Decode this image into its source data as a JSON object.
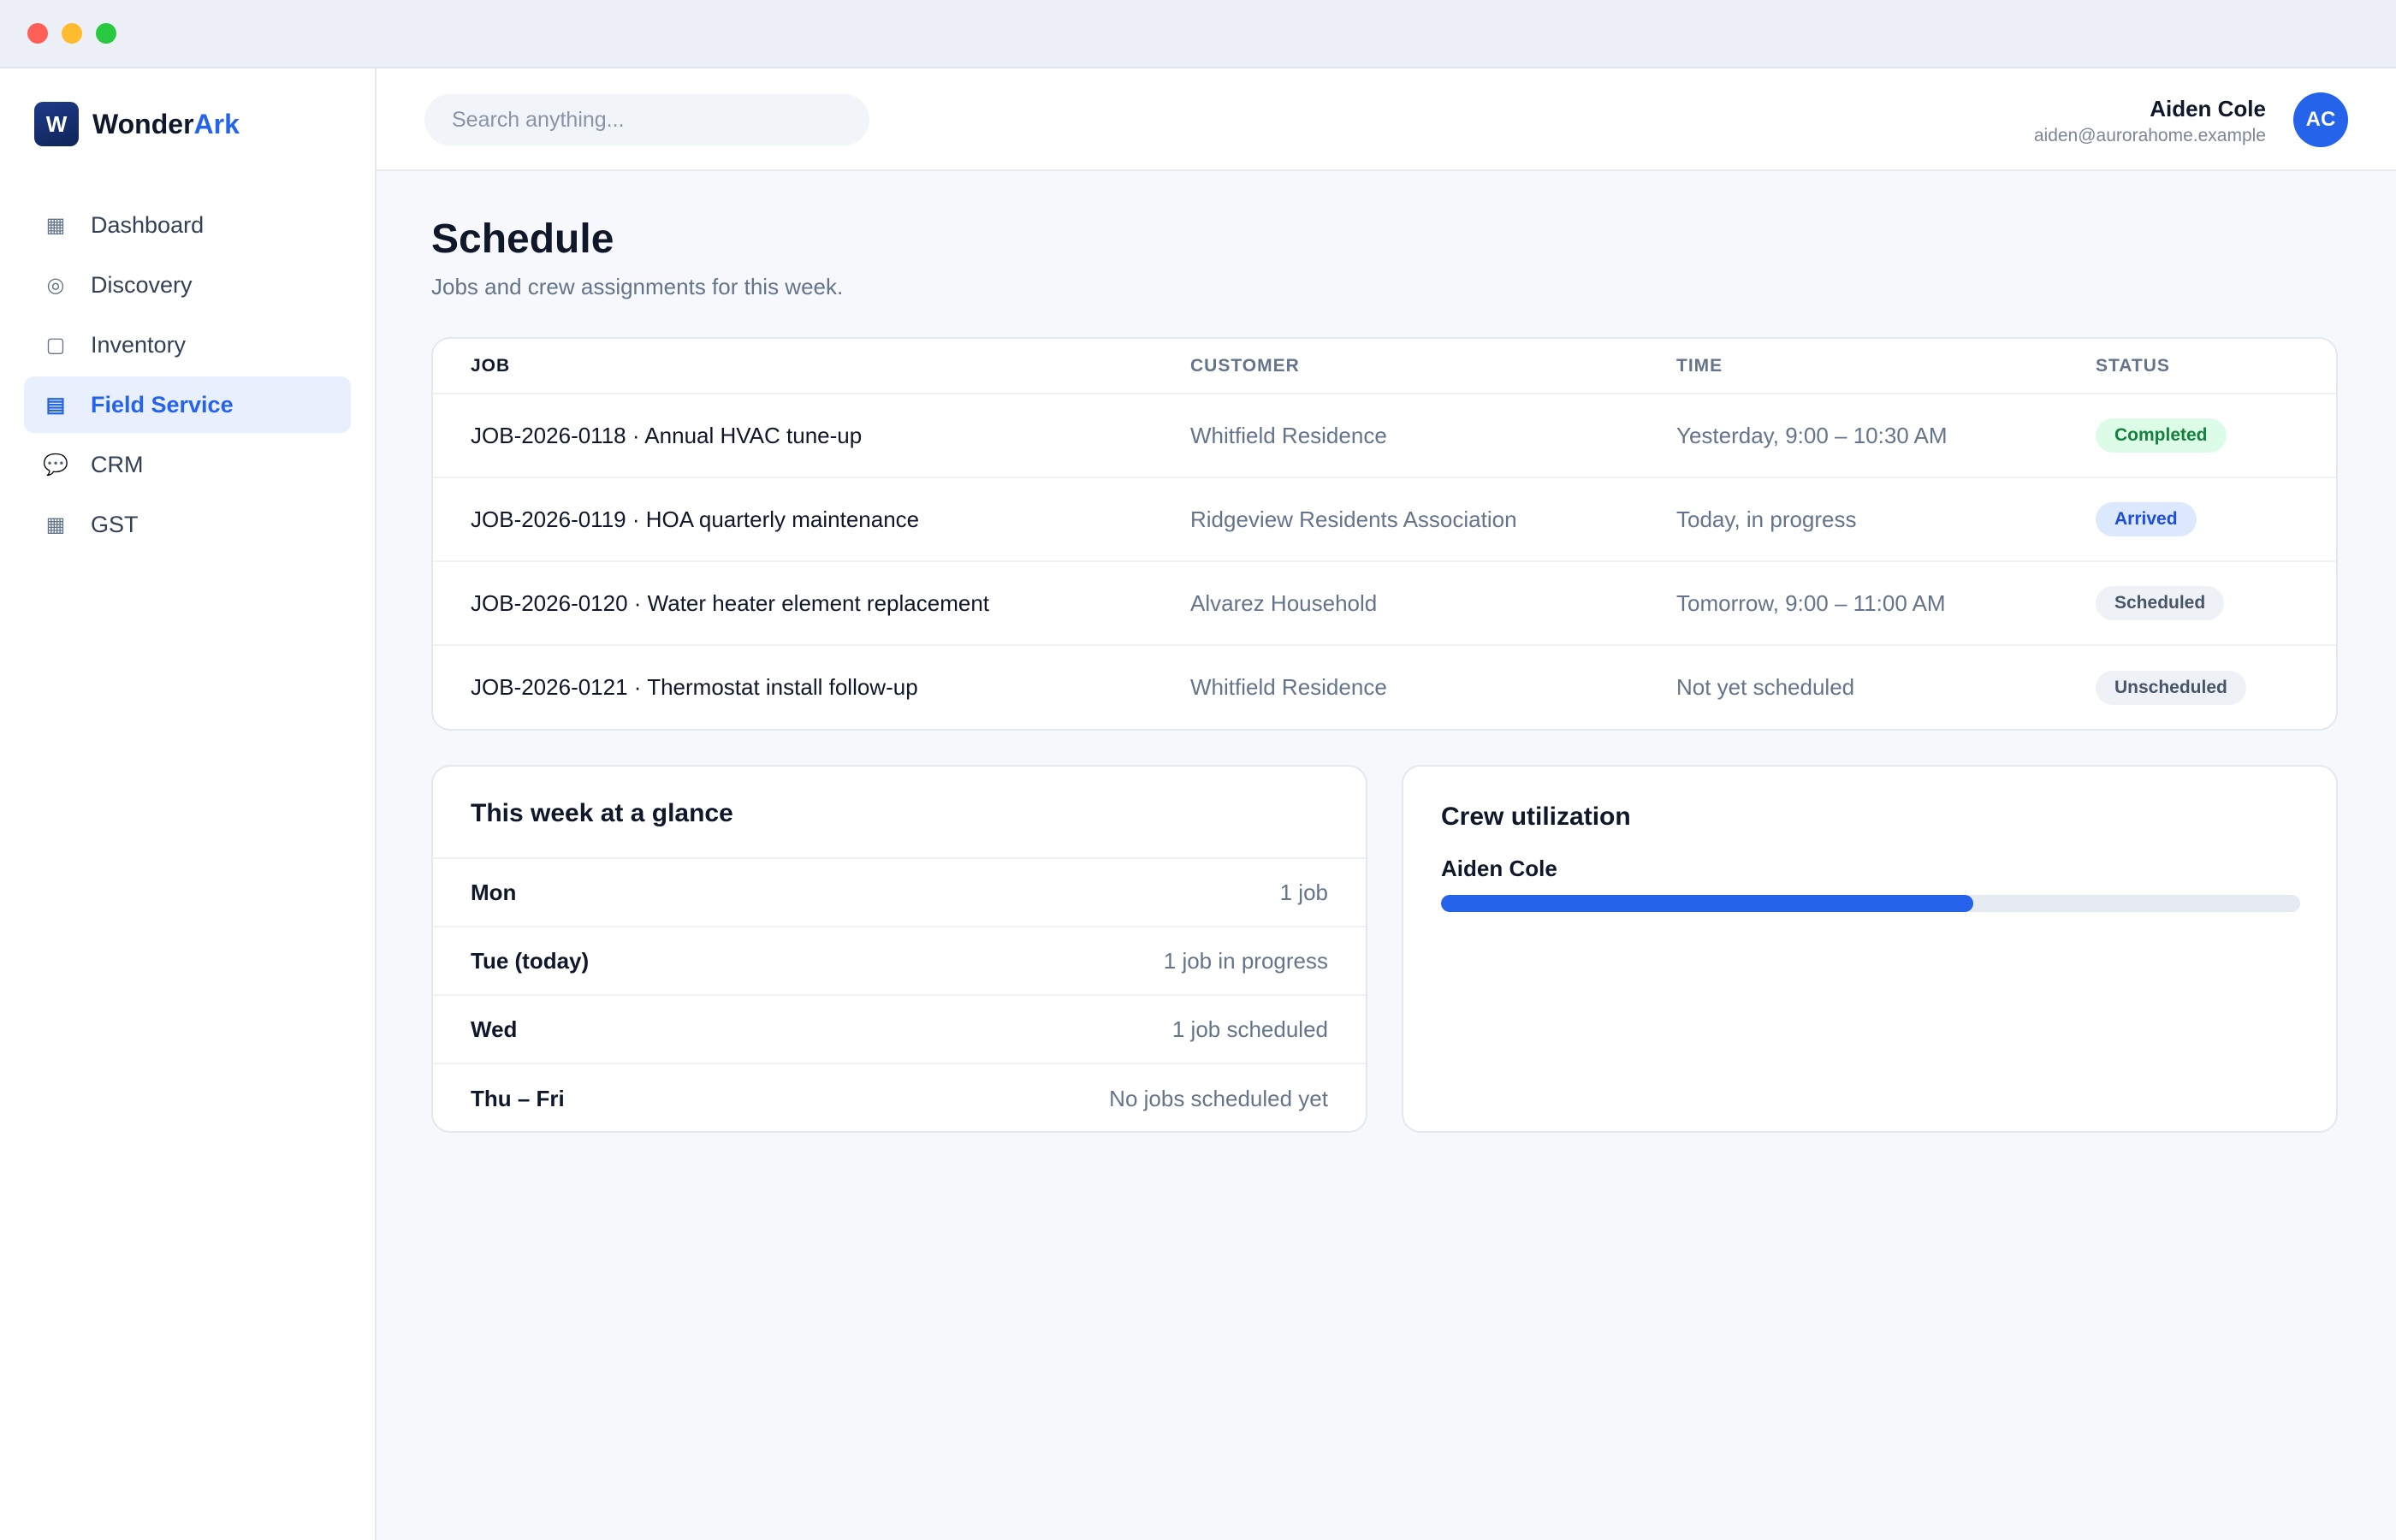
{
  "brand": {
    "logo_letter": "W",
    "name_part1": "Wonder",
    "name_part2": "Ark"
  },
  "sidebar": {
    "items": [
      {
        "label": "Dashboard",
        "icon": "dashboard-icon",
        "glyph": "▦",
        "active": false
      },
      {
        "label": "Discovery",
        "icon": "discovery-icon",
        "glyph": "◎",
        "active": false
      },
      {
        "label": "Inventory",
        "icon": "inventory-icon",
        "glyph": "▢",
        "active": false
      },
      {
        "label": "Field Service",
        "icon": "field-service-icon",
        "glyph": "▤",
        "active": true
      },
      {
        "label": "CRM",
        "icon": "crm-icon",
        "glyph": "💬",
        "active": false
      },
      {
        "label": "GST",
        "icon": "gst-icon",
        "glyph": "▦",
        "active": false
      }
    ]
  },
  "header": {
    "search_placeholder": "Search anything...",
    "user_name": "Aiden Cole",
    "user_email": "aiden@aurorahome.example",
    "avatar_initials": "AC"
  },
  "page": {
    "title": "Schedule",
    "subtitle": "Jobs and crew assignments for this week."
  },
  "jobs_table": {
    "headers": {
      "job": "JOB",
      "customer": "CUSTOMER",
      "time": "TIME",
      "status": "STATUS"
    },
    "rows": [
      {
        "job": "JOB-2026-0118 · Annual HVAC tune-up",
        "customer": "Whitfield Residence",
        "time": "Yesterday, 9:00 – 10:30 AM",
        "status": "Completed",
        "status_bg": "#dcfce7",
        "status_color": "#15803d"
      },
      {
        "job": "JOB-2026-0119 · HOA quarterly maintenance",
        "customer": "Ridgeview Residents Association",
        "time": "Today, in progress",
        "status": "Arrived",
        "status_bg": "#dbe8fd",
        "status_color": "#1d4ed8"
      },
      {
        "job": "JOB-2026-0120 · Water heater element replacement",
        "customer": "Alvarez Household",
        "time": "Tomorrow, 9:00 – 11:00 AM",
        "status": "Scheduled",
        "status_bg": "#eef1f5",
        "status_color": "#475569"
      },
      {
        "job": "JOB-2026-0121 · Thermostat install follow-up",
        "customer": "Whitfield Residence",
        "time": "Not yet scheduled",
        "status": "Unscheduled",
        "status_bg": "#eef1f5",
        "status_color": "#475569"
      }
    ]
  },
  "glance": {
    "title": "This week at a glance",
    "rows": [
      {
        "day": "Mon",
        "value": "1 job"
      },
      {
        "day": "Tue (today)",
        "value": "1 job in progress"
      },
      {
        "day": "Wed",
        "value": "1 job scheduled"
      },
      {
        "day": "Thu – Fri",
        "value": "No jobs scheduled yet"
      }
    ]
  },
  "crew": {
    "title": "Crew utilization",
    "members": [
      {
        "name": "Aiden Cole",
        "utilization": 0.62,
        "bar_color": "#2563eb"
      }
    ]
  }
}
